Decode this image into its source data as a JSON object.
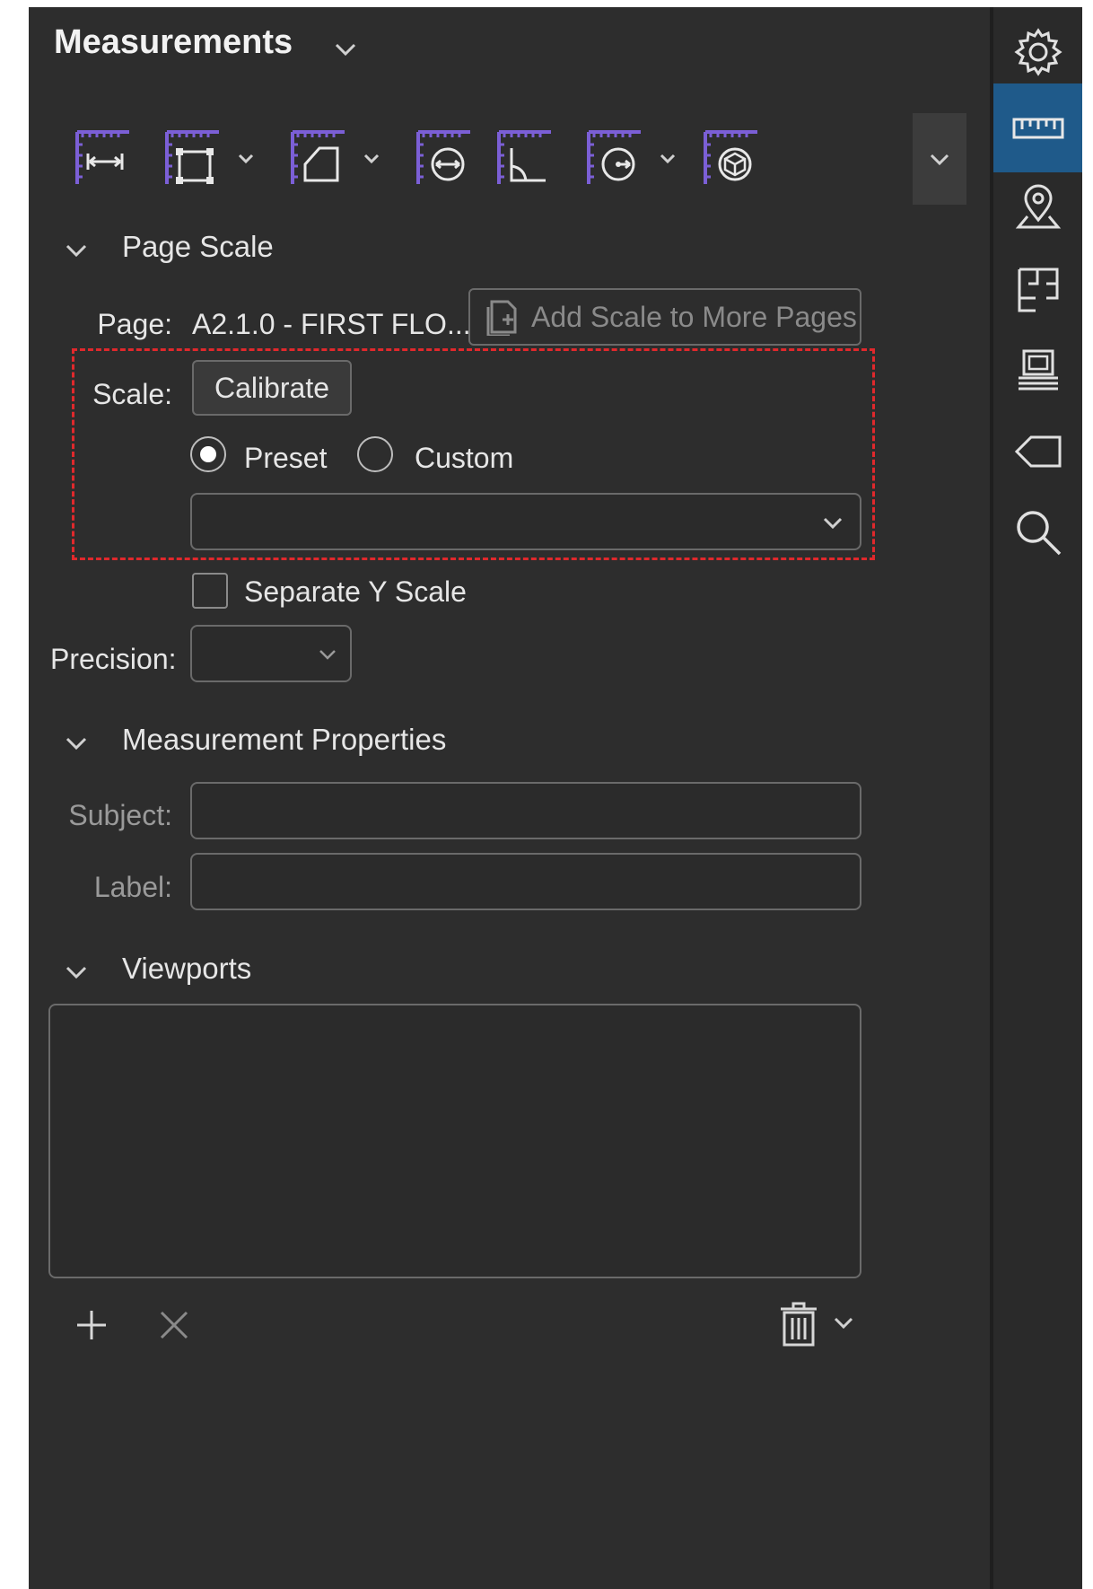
{
  "panel": {
    "title": "Measurements",
    "colors": {
      "background": "#2d2d2d",
      "accent": "#1f5a8a",
      "tool_icon_accent": "#7b5fd6",
      "highlight_border": "#e0282c"
    }
  },
  "toolbar": {
    "tools": [
      {
        "icon": "distance-measure-icon",
        "has_dropdown": false
      },
      {
        "icon": "perimeter-measure-icon",
        "has_dropdown": true
      },
      {
        "icon": "area-measure-icon",
        "has_dropdown": true
      },
      {
        "icon": "diameter-measure-icon",
        "has_dropdown": false
      },
      {
        "icon": "angle-measure-icon",
        "has_dropdown": false
      },
      {
        "icon": "radius-measure-icon",
        "has_dropdown": true
      },
      {
        "icon": "volume-measure-icon",
        "has_dropdown": false
      }
    ],
    "overflow_icon": "chevron-down-icon"
  },
  "page_scale": {
    "header": "Page Scale",
    "page_label": "Page:",
    "page_value": "A2.1.0 - FIRST FLO...",
    "add_scale_button": "Add Scale to More Pages",
    "scale_label": "Scale:",
    "calibrate_button": "Calibrate",
    "preset_label": "Preset",
    "custom_label": "Custom",
    "selected_mode": "Preset",
    "preset_value": "",
    "separate_y_label": "Separate Y Scale",
    "separate_y_checked": false,
    "precision_label": "Precision:",
    "precision_value": ""
  },
  "measurement_properties": {
    "header": "Measurement Properties",
    "subject_label": "Subject:",
    "subject_value": "",
    "label_label": "Label:",
    "label_value": ""
  },
  "viewports": {
    "header": "Viewports",
    "items": []
  },
  "footer": {
    "icons": [
      "add-icon",
      "remove-icon",
      "trash-icon",
      "chevron-down-icon"
    ]
  },
  "rail": {
    "icons": [
      "gear-icon",
      "ruler-icon",
      "location-pin-icon",
      "floor-plan-icon",
      "printer-icon",
      "tag-icon",
      "search-icon"
    ],
    "active": "ruler-icon"
  }
}
